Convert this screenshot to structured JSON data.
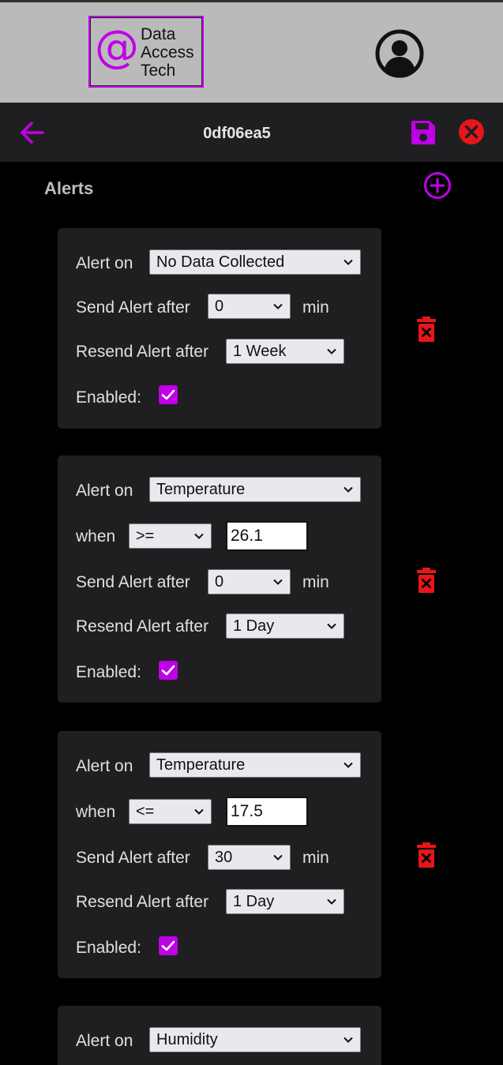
{
  "header": {
    "logo": {
      "at": "@",
      "lines": [
        "Data",
        "Access",
        "Tech"
      ]
    },
    "title": "0df06ea5"
  },
  "section": {
    "title": "Alerts"
  },
  "labels": {
    "alert_on": "Alert on",
    "when": "when",
    "send_after": "Send Alert after",
    "resend_after": "Resend Alert after",
    "enabled": "Enabled:",
    "min": "min"
  },
  "alerts": [
    {
      "alert_on": "No Data Collected",
      "send_after": "0",
      "resend_after": "1 Week",
      "enabled": true
    },
    {
      "alert_on": "Temperature",
      "operator": ">=",
      "threshold": "26.1",
      "send_after": "0",
      "resend_after": "1 Day",
      "enabled": true
    },
    {
      "alert_on": "Temperature",
      "operator": "<=",
      "threshold": "17.5",
      "send_after": "30",
      "resend_after": "1 Day",
      "enabled": true
    },
    {
      "alert_on": "Humidity"
    }
  ],
  "colors": {
    "accent": "#c000e8",
    "danger": "#e8151b",
    "card": "#1f1f21",
    "topbar": "#bababa"
  },
  "icons": [
    "back-arrow-icon",
    "save-icon",
    "close-icon",
    "add-circle-icon",
    "user-avatar-icon",
    "trash-icon",
    "chevron-down-icon",
    "check-icon"
  ]
}
